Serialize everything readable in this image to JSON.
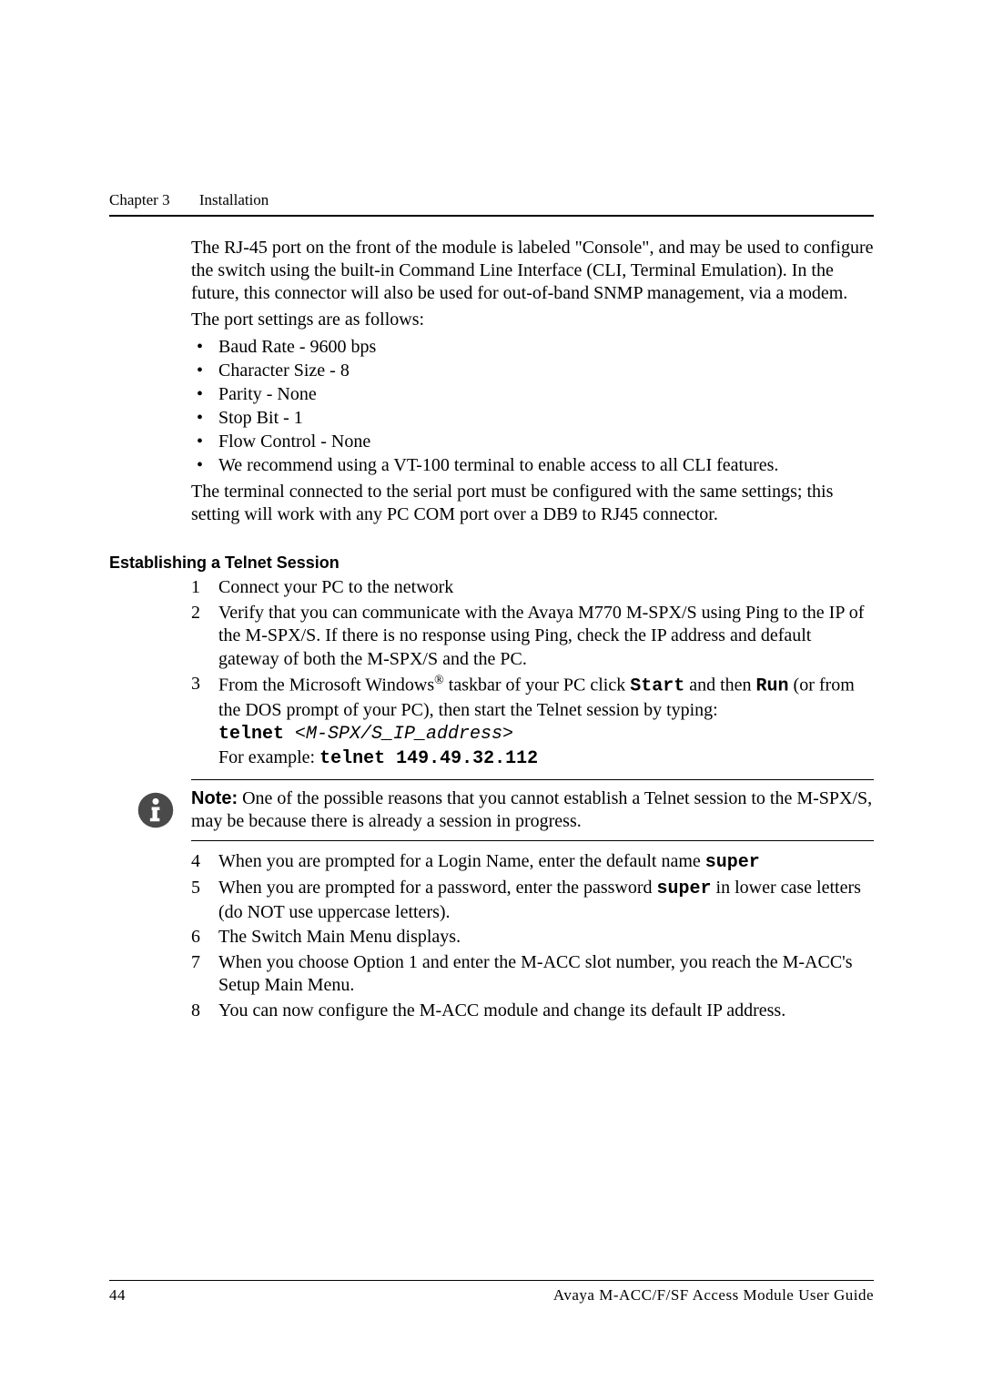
{
  "header": {
    "chapter": "Chapter 3",
    "title": "Installation"
  },
  "intro_para": "The RJ-45 port on the front of the module is labeled \"Console\", and may be used to configure the switch using the built-in Command Line Interface (CLI, Terminal Emulation). In the future, this connector will also be used for out-of-band SNMP management, via a modem.",
  "port_intro": "The port settings are as follows:",
  "bullets": [
    "Baud Rate - 9600 bps",
    "Character Size - 8",
    "Parity - None",
    "Stop Bit - 1",
    "Flow Control - None",
    "We recommend using a VT-100 terminal to enable access to all CLI features."
  ],
  "post_bullets": "The terminal connected to the serial port must be configured with the same settings; this setting will work with any PC COM port over a DB9 to RJ45 connector.",
  "section_heading": "Establishing a Telnet Session",
  "steps_a": {
    "s1": "Connect your PC to the network",
    "s2": "Verify that you can communicate with the Avaya M770 M-SPX/S using Ping to the IP of the M-SPX/S. If there is no response using Ping, check the IP address and default gateway of both the M-SPX/S and the PC.",
    "s3_pre": "From the Microsoft Windows",
    "s3_sup": "®",
    "s3_mid": " taskbar of your PC click ",
    "s3_start": "Start",
    "s3_andthen": " and then ",
    "s3_run": "Run",
    "s3_line2": " (or from the DOS prompt of your PC), then start the Telnet session by typing:",
    "s3_cmd1": "telnet",
    "s3_cmd1b": " <M-SPX/S_IP_address>",
    "s3_example_label": "For example: ",
    "s3_example_cmd": "telnet 149.49.32.112"
  },
  "note": {
    "label": "Note:",
    "text": "  One of the possible reasons that you cannot establish a Telnet session to the M-SPX/S, may be because there is already a session in progress."
  },
  "steps_b": {
    "s4_pre": "When you are prompted for a Login Name, enter the default name  ",
    "s4_cmd": "super",
    "s5_pre": "When you are prompted for a password, enter the password  ",
    "s5_cmd": "super",
    "s5_post": "  in lower case letters (do NOT use uppercase letters).",
    "s6": "The Switch Main Menu displays.",
    "s7": "When you choose Option 1 and enter the M-ACC slot number, you reach the M-ACC's Setup Main Menu.",
    "s8": "You can now configure the M-ACC module and change its default IP address."
  },
  "footer": {
    "page": "44",
    "doc": "Avaya M-ACC/F/SF Access Module User Guide"
  }
}
